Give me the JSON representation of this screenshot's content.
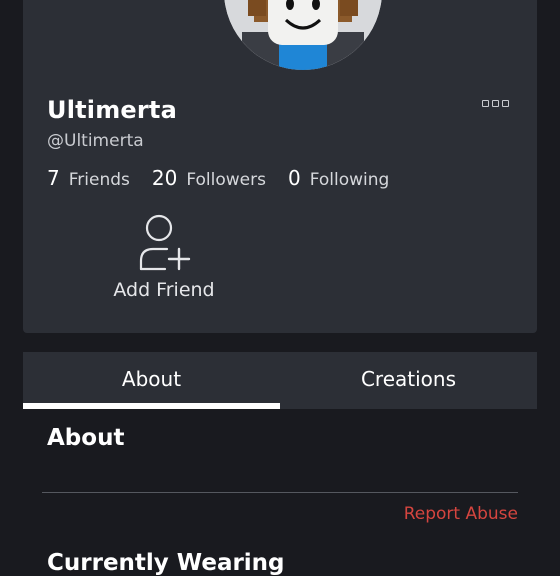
{
  "profile": {
    "display_name": "Ultimerta",
    "handle": "@Ultimerta",
    "stats": [
      {
        "count": "7",
        "label": "Friends"
      },
      {
        "count": "20",
        "label": "Followers"
      },
      {
        "count": "0",
        "label": "Following"
      }
    ],
    "more_icon": "more-options-icon",
    "add_friend_label": "Add Friend",
    "add_friend_icon": "add-friend-icon"
  },
  "tabs": [
    {
      "label": "About",
      "active": true
    },
    {
      "label": "Creations",
      "active": false
    }
  ],
  "about": {
    "title": "About",
    "report_label": "Report Abuse",
    "next_section_title": "Currently Wearing"
  },
  "colors": {
    "background": "#191a1f",
    "card": "#2c2f36",
    "report": "#d5453f",
    "tab_indicator": "#ffffff"
  }
}
